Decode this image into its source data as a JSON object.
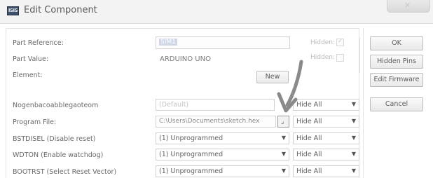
{
  "window": {
    "icon_text": "ISIS",
    "title": "Edit Component",
    "close_glyph": "✕"
  },
  "fields": {
    "part_reference": {
      "label": "Part Reference:",
      "value": "SIM1",
      "hidden_label": "Hidden:",
      "hidden_checked": true
    },
    "part_value": {
      "label": "Part Value:",
      "value": "ARDUINO UNO",
      "hidden_label": "Hidden:",
      "hidden_checked": false
    },
    "element": {
      "label": "Element:",
      "new_button": "New"
    }
  },
  "properties": [
    {
      "label": "Nogenbacoabblegaoteom",
      "value": "(Default)",
      "visibility": "Hide All",
      "dim": true,
      "browse": false
    },
    {
      "label": "Program File:",
      "value": "C:\\Users\\Documents\\sketch.hex",
      "visibility": "Hide All",
      "dim": false,
      "browse": true
    },
    {
      "label": "BSTDISEL (Disable reset)",
      "value": "(1) Unprogrammed",
      "visibility": "Hide All",
      "dim": false,
      "browse": false
    },
    {
      "label": "WDTON (Enable watchdog)",
      "value": "(1) Unprogrammed",
      "visibility": "Hide All",
      "dim": false,
      "browse": false
    },
    {
      "label": "BOOTRST (Select Reset Vector)",
      "value": "(1) Unprogrammed",
      "visibility": "Hide All",
      "dim": false,
      "browse": false
    }
  ],
  "buttons": {
    "ok": "OK",
    "hidden_pins": "Hidden Pins",
    "edit_firmware": "Edit Firmware",
    "cancel": "Cancel"
  },
  "icons": {
    "dropdown": "chevron-down-icon",
    "browse": "folder-browse-icon",
    "annotation": "arrow-annotation-icon",
    "annotation_color": "#8a8a8a"
  }
}
